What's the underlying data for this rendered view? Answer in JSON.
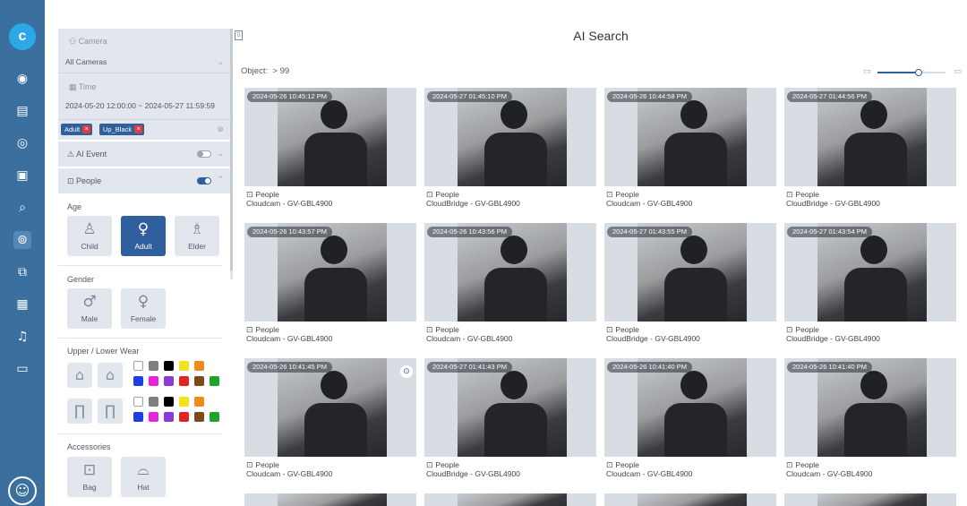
{
  "sidebar": {
    "logo": "c",
    "items": [
      {
        "name": "playback-icon",
        "glyph": "◉"
      },
      {
        "name": "list-icon",
        "glyph": "▤"
      },
      {
        "name": "eye-icon",
        "glyph": "◎"
      },
      {
        "name": "monitor-icon",
        "glyph": "▣"
      },
      {
        "name": "search-icon",
        "glyph": "⌕"
      },
      {
        "name": "ai-search-icon",
        "glyph": "⊚",
        "active": true
      },
      {
        "name": "export-icon",
        "glyph": "⧉"
      },
      {
        "name": "archive-icon",
        "glyph": "▦"
      },
      {
        "name": "bell-icon",
        "glyph": "♫"
      },
      {
        "name": "folder-icon",
        "glyph": "▭"
      }
    ],
    "avatar": "☺"
  },
  "filter": {
    "camera": {
      "label": "Camera",
      "value": "All Cameras"
    },
    "time": {
      "label": "Time",
      "value": "2024-05-20 12:00:00  ~  2024-05-27 11:59:59"
    },
    "tags": [
      "Adult",
      "Up_Black"
    ],
    "ai_event": {
      "label": "AI Event",
      "enabled": false
    },
    "people": {
      "label": "People",
      "enabled": true
    },
    "age": {
      "title": "Age",
      "options": [
        {
          "label": "Child",
          "glyph": "♙",
          "selected": false
        },
        {
          "label": "Adult",
          "glyph": "♀",
          "selected": true
        },
        {
          "label": "Elder",
          "glyph": "♗",
          "selected": false
        }
      ]
    },
    "gender": {
      "title": "Gender",
      "options": [
        {
          "label": "Male",
          "glyph": "♂",
          "selected": false
        },
        {
          "label": "Female",
          "glyph": "♀",
          "selected": false
        }
      ]
    },
    "wear": {
      "title": "Upper / Lower Wear",
      "upper_glyphs": [
        "⌂",
        "⌂"
      ],
      "lower_glyphs": [
        "∏",
        "∏"
      ],
      "colors": [
        "#ffffff",
        "#7f7f7f",
        "#000000",
        "#f2e31c",
        "#f08a17",
        "#1f3fe0",
        "#e824d8",
        "#8a3bd6",
        "#e02424",
        "#7a4a1c",
        "#1fa32b"
      ]
    },
    "accessories": {
      "title": "Accessories",
      "options": [
        {
          "label": "Bag",
          "glyph": "⊡"
        },
        {
          "label": "Hat",
          "glyph": "⌓"
        }
      ]
    }
  },
  "main": {
    "title": "AI Search",
    "object_label": "Object:",
    "object_count": "> 99",
    "zoom_value": 0.6,
    "cards": [
      {
        "ts": "2024-05-26 10:45:12 PM",
        "cat": "People",
        "src": "Cloudcam - GV-GBL4900"
      },
      {
        "ts": "2024-05-27 01:45:10 PM",
        "cat": "People",
        "src": "CloudBridge - GV-GBL4900"
      },
      {
        "ts": "2024-05-26 10:44:58 PM",
        "cat": "People",
        "src": "Cloudcam - GV-GBL4900"
      },
      {
        "ts": "2024-05-27 01:44:56 PM",
        "cat": "People",
        "src": "CloudBridge - GV-GBL4900"
      },
      {
        "ts": "2024-05-26 10:43:57 PM",
        "cat": "People",
        "src": "Cloudcam - GV-GBL4900"
      },
      {
        "ts": "2024-05-26 10:43:56 PM",
        "cat": "People",
        "src": "Cloudcam - GV-GBL4900"
      },
      {
        "ts": "2024-05-27 01:43:55 PM",
        "cat": "People",
        "src": "CloudBridge - GV-GBL4900"
      },
      {
        "ts": "2024-05-27 01:43:54 PM",
        "cat": "People",
        "src": "CloudBridge - GV-GBL4900"
      },
      {
        "ts": "2024-05-26 10:41:45 PM",
        "cat": "People",
        "src": "Cloudcam - GV-GBL4900",
        "hover": true
      },
      {
        "ts": "2024-05-27 01:41:43 PM",
        "cat": "People",
        "src": "CloudBridge - GV-GBL4900"
      },
      {
        "ts": "2024-05-26 10:41:40 PM",
        "cat": "People",
        "src": "Cloudcam - GV-GBL4900"
      },
      {
        "ts": "2024-05-26 10:41:40 PM",
        "cat": "People",
        "src": "Cloudcam - GV-GBL4900"
      }
    ]
  }
}
